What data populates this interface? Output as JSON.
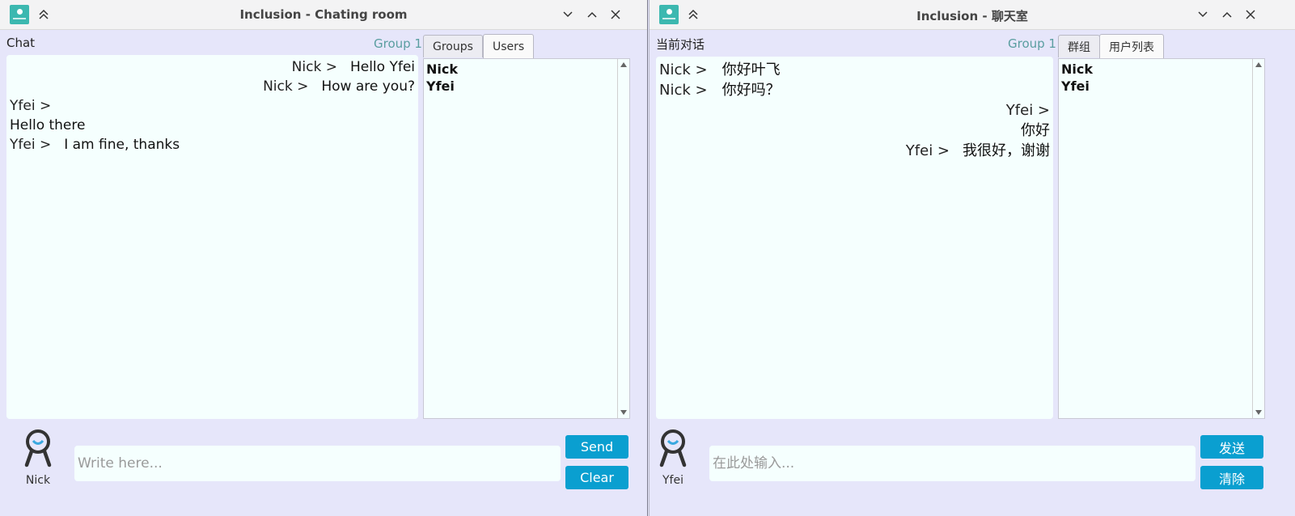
{
  "colors": {
    "window_bg": "#e6e6fa",
    "panel_bg": "#f5fffe",
    "accent_button": "#0a9fd0",
    "group_text": "#5a9ea0",
    "app_icon": "#3cb8b0"
  },
  "left": {
    "title": "Inclusion - Chating room",
    "chat_label": "Chat",
    "group_label": "Group 1",
    "tabs": [
      "Groups",
      "Users"
    ],
    "active_tab": "Users",
    "messages": [
      {
        "sender": "Nick >",
        "text": "Hello Yfei",
        "align": "right"
      },
      {
        "sender": "Nick >",
        "text": "How are you?",
        "align": "right"
      },
      {
        "sender": "Yfei >",
        "text": "",
        "align": "left"
      },
      {
        "sender": "",
        "text": "Hello there",
        "align": "left"
      },
      {
        "sender": "Yfei >",
        "text": "I am fine, thanks",
        "align": "left"
      }
    ],
    "users": [
      "Nick",
      "Yfei"
    ],
    "avatar_name": "Nick",
    "input": {
      "value": "",
      "placeholder": "Write here..."
    },
    "send_label": "Send",
    "clear_label": "Clear"
  },
  "right": {
    "title": "Inclusion - 聊天室",
    "chat_label": "当前对话",
    "group_label": "Group 1",
    "tabs": [
      "群组",
      "用户列表"
    ],
    "active_tab": "用户列表",
    "messages": [
      {
        "sender": "Nick >",
        "text": "你好叶飞",
        "align": "left"
      },
      {
        "sender": "Nick >",
        "text": "你好吗？",
        "align": "left"
      },
      {
        "sender": "Yfei >",
        "text": "",
        "align": "right"
      },
      {
        "sender": "",
        "text": "你好",
        "align": "right"
      },
      {
        "sender": "Yfei >",
        "text": "我很好，谢谢",
        "align": "right"
      }
    ],
    "users": [
      "Nick",
      "Yfei"
    ],
    "avatar_name": "Yfei",
    "input": {
      "value": "",
      "placeholder": "在此处输入..."
    },
    "send_label": "发送",
    "clear_label": "清除"
  },
  "icons": {
    "app": "inclusion-app-icon",
    "shade": "chevrons-up-icon",
    "minimize": "chevron-down-icon",
    "maximize": "chevron-up-icon",
    "close": "close-icon",
    "avatar": "user-avatar-icon"
  }
}
